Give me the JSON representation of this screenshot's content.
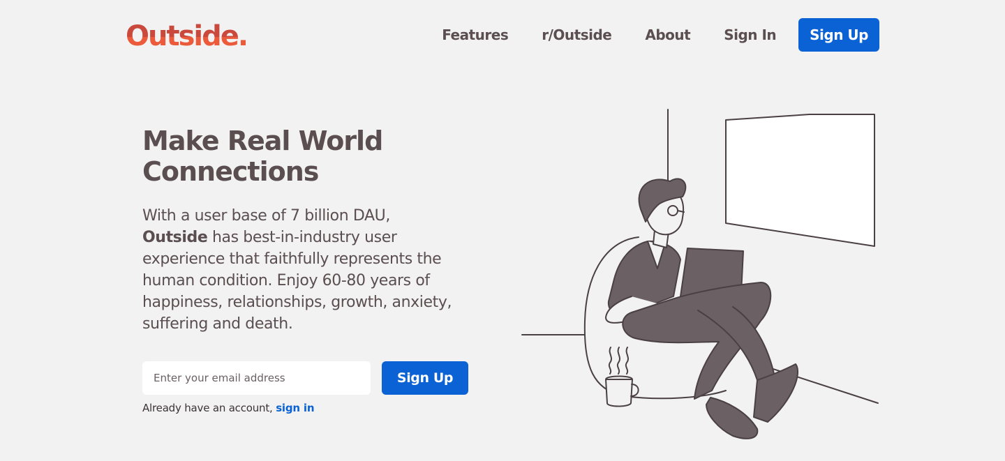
{
  "header": {
    "logo_text": "Outside.",
    "nav": [
      {
        "label": "Features"
      },
      {
        "label": "r/Outside"
      },
      {
        "label": "About"
      },
      {
        "label": "Sign In"
      }
    ],
    "signup_label": "Sign Up"
  },
  "hero": {
    "title": "Make Real World Connections",
    "desc_prefix": "With a user base of 7 billion DAU,",
    "desc_brand": "Outside",
    "desc_rest": "has best-in-industry user experience that faithfully represents the human condition. Enjoy 60-80 years of happiness, relationships, growth, anxiety, suffering and death."
  },
  "signup": {
    "email_placeholder": "Enter your email address",
    "email_value": "",
    "button_label": "Sign Up",
    "signin_prompt": "Already have an account,",
    "signin_link": "sign in"
  },
  "illustration": {
    "subject": "person-with-laptop-in-beanbag-icon"
  },
  "colors": {
    "background": "#f2f2f2",
    "brand_red": "#e8523b",
    "primary_blue": "#0a62d4",
    "text": "#5a4e51",
    "figure": "#6b6063"
  }
}
